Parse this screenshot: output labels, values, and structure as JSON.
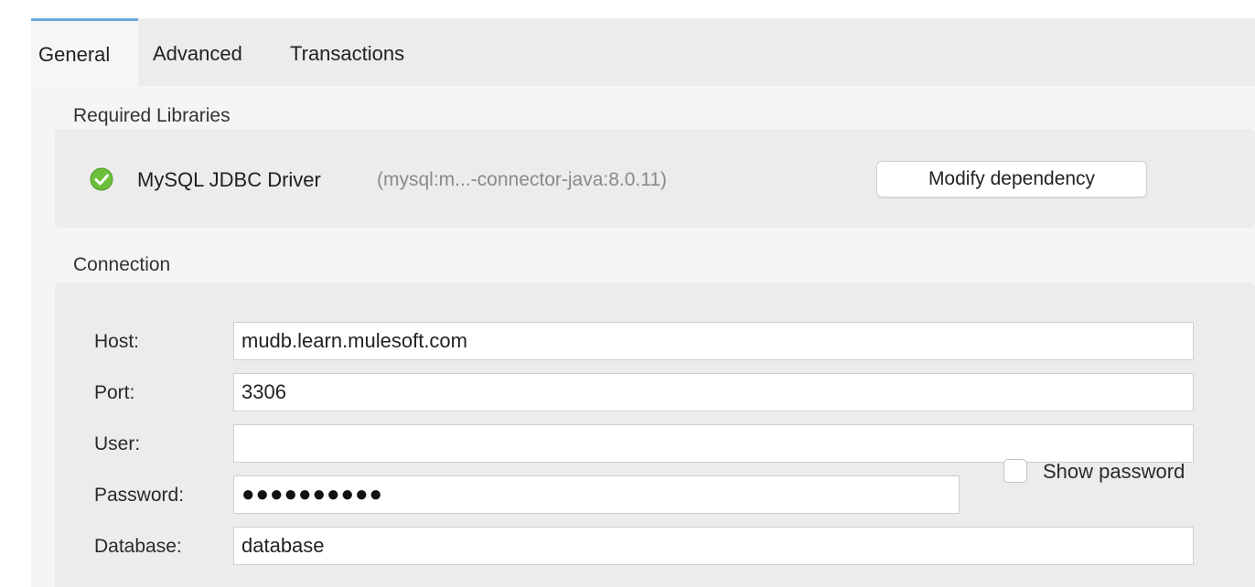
{
  "tabs": [
    {
      "label": "General",
      "active": true
    },
    {
      "label": "Advanced",
      "active": false
    },
    {
      "label": "Transactions",
      "active": false
    }
  ],
  "required_libraries": {
    "title": "Required Libraries",
    "driver_name": "MySQL JDBC Driver",
    "driver_coordinates": "(mysql:m...-connector-java:8.0.11)",
    "status_icon": "check-circle-icon",
    "status_color": "#6bbf3a",
    "modify_button_label": "Modify dependency"
  },
  "connection": {
    "title": "Connection",
    "host": {
      "label": "Host:",
      "value": "mudb.learn.mulesoft.com"
    },
    "port": {
      "label": "Port:",
      "value": "3306"
    },
    "user": {
      "label": "User:",
      "value": ""
    },
    "password": {
      "label": "Password:",
      "value": "●●●●●●●●●●",
      "show_password_label": "Show password",
      "show_password_checked": false
    },
    "database": {
      "label": "Database:",
      "value": "database"
    }
  },
  "colors": {
    "active_tab_accent": "#6fa6d8"
  }
}
